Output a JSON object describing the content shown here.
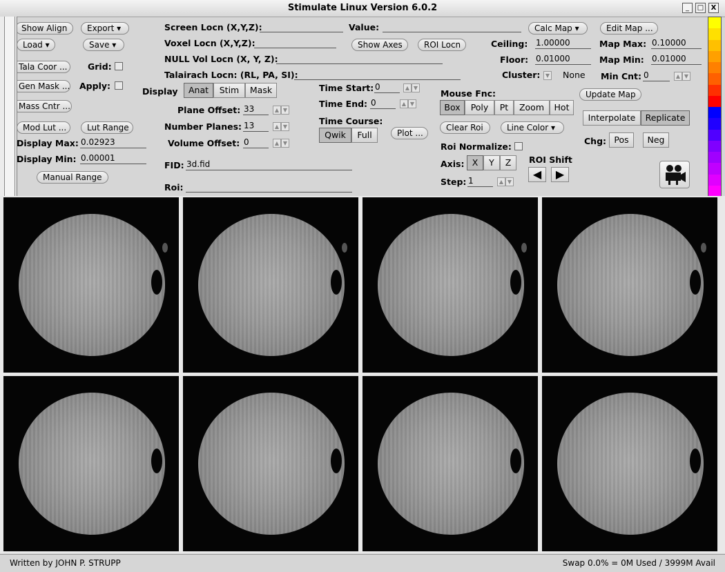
{
  "window": {
    "title": "Stimulate Linux Version 6.0.2",
    "minimize": "_",
    "maximize": "□",
    "close": "X"
  },
  "left": {
    "show_align": "Show Align",
    "export": "Export",
    "load": "Load",
    "save": "Save",
    "tala_coor": "Tala Coor ...",
    "grid_label": "Grid:",
    "gen_mask": "Gen Mask ...",
    "apply_label": "Apply:",
    "mass_cntr": "Mass Cntr ...",
    "mod_lut": "Mod Lut ...",
    "lut_range": "Lut Range",
    "display_max_label": "Display Max:",
    "display_max_value": "0.02923",
    "display_min_label": "Display Min:",
    "display_min_value": "0.00001",
    "manual_range": "Manual Range"
  },
  "center": {
    "screen_locn": "Screen Locn (X,Y,Z):",
    "value_label": "Value:",
    "voxel_locn": "Voxel Locn (X,Y,Z):",
    "show_axes": "Show Axes",
    "roi_locn": "ROI Locn",
    "null_vol_locn": "NULL Vol Locn (X, Y, Z):",
    "talairach_locn": "Talairach Locn: (RL, PA, SI):",
    "display_label": "Display",
    "display_modes": [
      "Anat",
      "Stim",
      "Mask"
    ],
    "plane_offset_label": "Plane Offset:",
    "plane_offset_value": "33",
    "number_planes_label": "Number Planes:",
    "number_planes_value": "13",
    "volume_offset_label": "Volume Offset:",
    "volume_offset_value": "0",
    "fid_label": "FID:",
    "fid_value": "3d.fid",
    "roi_label": "Roi:",
    "time_start_label": "Time Start:",
    "time_start_value": "0",
    "time_end_label": "Time End:",
    "time_end_value": "0",
    "time_course_label": "Time Course:",
    "time_course_modes": [
      "Qwik",
      "Full"
    ],
    "plot": "Plot ..."
  },
  "mouse": {
    "mouse_fnc_label": "Mouse Fnc:",
    "modes": [
      "Box",
      "Poly",
      "Pt",
      "Zoom",
      "Hot"
    ],
    "clear_roi": "Clear Roi",
    "line_color": "Line Color",
    "roi_normalize_label": "Roi Normalize:",
    "axis_label": "Axis:",
    "axes": [
      "X",
      "Y",
      "Z"
    ],
    "roi_shift_label": "ROI Shift",
    "step_label": "Step:",
    "step_value": "1"
  },
  "map": {
    "calc_map": "Calc Map",
    "edit_map": "Edit Map ...",
    "ceiling_label": "Ceiling:",
    "ceiling_value": "1.00000",
    "map_max_label": "Map Max:",
    "map_max_value": "0.10000",
    "floor_label": "Floor:",
    "floor_value": "0.01000",
    "map_min_label": "Map Min:",
    "map_min_value": "0.01000",
    "cluster_label": "Cluster:",
    "cluster_value": "None",
    "min_cnt_label": "Min Cnt:",
    "min_cnt_value": "0",
    "update_map": "Update Map",
    "interpolate": "Interpolate",
    "replicate": "Replicate",
    "chg_label": "Chg:",
    "pos": "Pos",
    "neg": "Neg"
  },
  "colorbar": [
    "#ffff00",
    "#ffe000",
    "#ffc000",
    "#ffa000",
    "#ff8000",
    "#ff6000",
    "#ff3000",
    "#ff0000",
    "#0000ff",
    "#2000ff",
    "#5000ff",
    "#8000ff",
    "#a000ff",
    "#c000ff",
    "#e000ff",
    "#ff00ff"
  ],
  "status": {
    "left": "Written by JOHN P. STRUPP",
    "right": "Swap 0.0% = 0M Used / 3999M Avail"
  }
}
